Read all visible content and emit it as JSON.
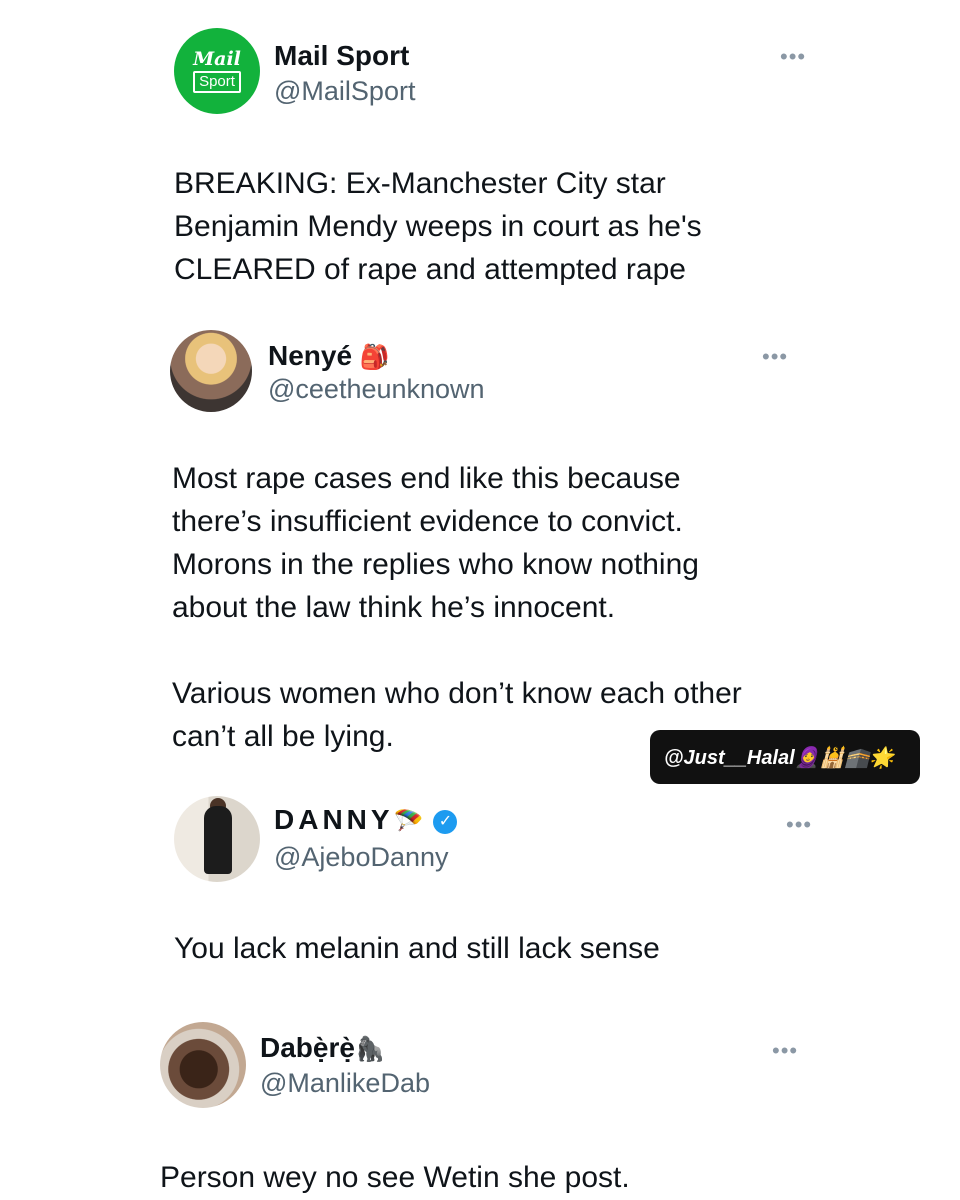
{
  "tweets": [
    {
      "name": "Mail Sport",
      "handle": "@MailSport",
      "text": "BREAKING: Ex-Manchester City star\nBenjamin Mendy weeps in court as he's\nCLEARED of rape and attempted rape",
      "logo_top": "Mail",
      "logo_bottom": "Sport",
      "more": "•••"
    },
    {
      "name": "Nenyé",
      "name_emoji": "🎒",
      "handle": "@ceetheunknown",
      "text": "Most rape cases end like this because\nthere’s insufficient evidence to convict.\nMorons in the replies who know nothing\nabout the law think he’s innocent.\n\nVarious women who don’t know each other\ncan’t all be lying.",
      "more": "•••"
    },
    {
      "name": "DANNY",
      "name_emoji": "🪂",
      "verified": "✓",
      "handle": "@AjeboDanny",
      "text": "You lack melanin and still lack sense",
      "more": "•••"
    },
    {
      "name": "Dabẹ̀rẹ̀",
      "name_emoji": "🦍",
      "handle": "@ManlikeDab",
      "text": "Person wey no see Wetin she post.",
      "more": "•••"
    }
  ],
  "watermark": "@Just__Halal🧕🕌🕋🌟",
  "colors": {
    "text": "#0f1419",
    "secondary": "#536471",
    "mail_green": "#12b23c",
    "verified_blue": "#1d9bf0"
  }
}
